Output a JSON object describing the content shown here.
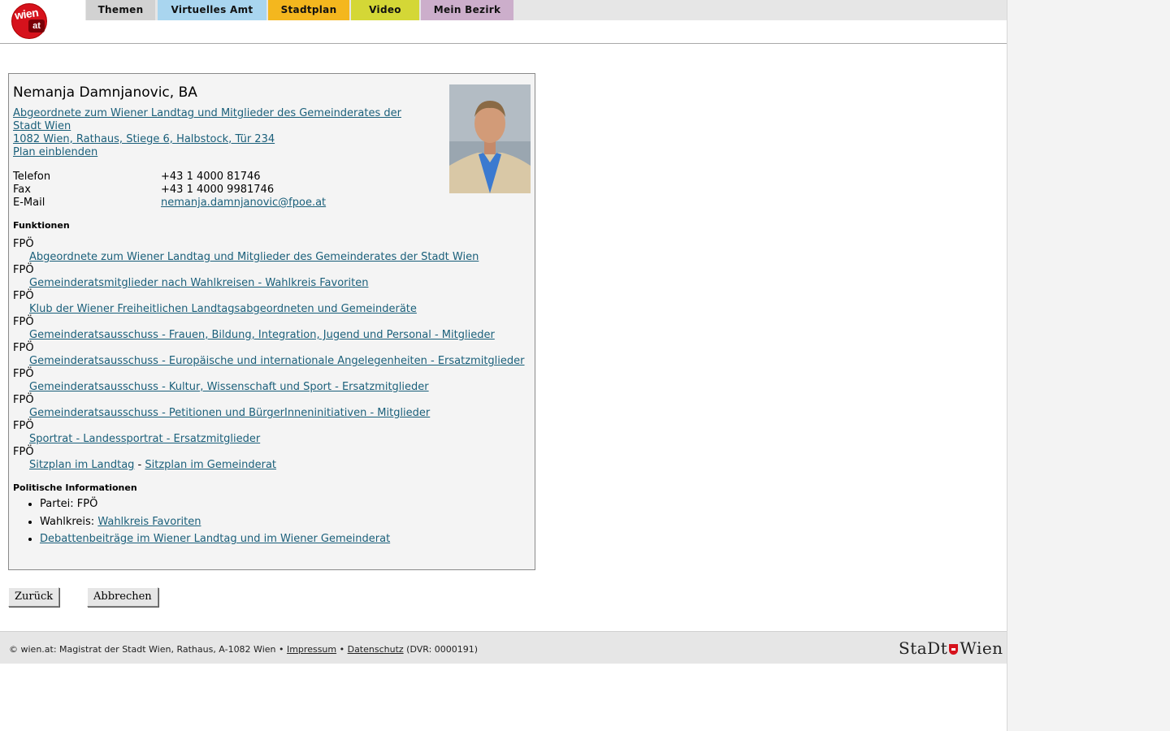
{
  "nav": {
    "logo_top": "wien",
    "logo_bottom": "at",
    "tabs": [
      {
        "label": "Themen",
        "color": "#d2d2d2"
      },
      {
        "label": "Virtuelles Amt",
        "color": "#a9d5ef"
      },
      {
        "label": "Stadtplan",
        "color": "#f4b71e"
      },
      {
        "label": "Video",
        "color": "#d4d736"
      },
      {
        "label": "Mein Bezirk",
        "color": "#ccaecb"
      }
    ]
  },
  "person": {
    "name": "Nemanja Damnjanovic, BA",
    "role_line1": "Abgeordnete zum Wiener Landtag und Mitglieder des Gemeinderates der",
    "role_line2": "Stadt Wien",
    "address": "1082 Wien, Rathaus, Stiege 6, Halbstock, Tür 234",
    "plan_link": "Plan einblenden",
    "contacts": [
      {
        "label": "Telefon",
        "value": "+43 1 4000 81746"
      },
      {
        "label": "Fax",
        "value": "+43 1 4000 9981746"
      },
      {
        "label": "E-Mail",
        "value": "nemanja.damnjanovic@fpoe.at"
      }
    ]
  },
  "funktionen": {
    "heading": "Funktionen",
    "items": [
      {
        "party": "FPÖ",
        "text": "Abgeordnete zum Wiener Landtag und Mitglieder des Gemeinderates der Stadt Wien"
      },
      {
        "party": "FPÖ",
        "text": "Gemeinderatsmitglieder nach Wahlkreisen - Wahlkreis Favoriten"
      },
      {
        "party": "FPÖ",
        "text": "Klub der Wiener Freiheitlichen Landtagsabgeordneten und Gemeinderäte"
      },
      {
        "party": "FPÖ",
        "text": "Gemeinderatsausschuss - Frauen, Bildung, Integration, Jugend und Personal - Mitglieder"
      },
      {
        "party": "FPÖ",
        "text": "Gemeinderatsausschuss - Europäische und internationale Angelegenheiten - Ersatzmitglieder"
      },
      {
        "party": "FPÖ",
        "text": "Gemeinderatsausschuss - Kultur, Wissenschaft und Sport - Ersatzmitglieder"
      },
      {
        "party": "FPÖ",
        "text": "Gemeinderatsausschuss - Petitionen und BürgerInneninitiativen - Mitglieder"
      },
      {
        "party": "FPÖ",
        "text": "Sportrat - Landessportrat - Ersatzmitglieder"
      }
    ],
    "last_party": "FPÖ",
    "sitzplan_landtag": "Sitzplan im Landtag",
    "sitzplan_sep": " - ",
    "sitzplan_gemeinderat": "Sitzplan im Gemeinderat"
  },
  "politisch": {
    "heading": "Politische Informationen",
    "partei_label": "Partei: ",
    "partei_value": "FPÖ",
    "wahlkreis_label": "Wahlkreis: ",
    "wahlkreis_value": "Wahlkreis Favoriten",
    "debatten": "Debattenbeiträge im Wiener Landtag und im Wiener Gemeinderat"
  },
  "buttons": {
    "back": "Zurück",
    "cancel": "Abbrechen"
  },
  "footer": {
    "copyright": "© wien.at: Magistrat der Stadt Wien, Rathaus, A-1082 Wien • ",
    "impressum": "Impressum",
    "sep": " • ",
    "datenschutz": "Datenschutz",
    "dvr": " (DVR: 0000191)",
    "logo_left": "StaDt",
    "logo_right": "Wien"
  }
}
